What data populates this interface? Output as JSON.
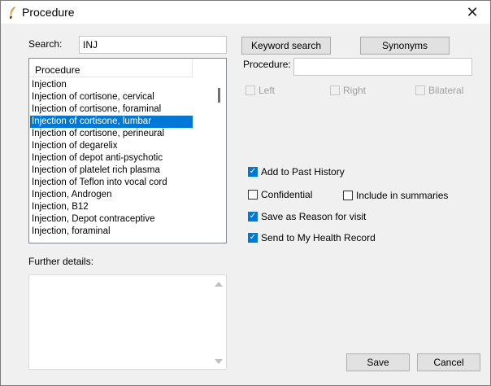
{
  "window": {
    "title": "Procedure",
    "close_glyph": "✕"
  },
  "search": {
    "label": "Search:",
    "value": "INJ"
  },
  "buttons": {
    "keyword_search": "Keyword search",
    "synonyms": "Synonyms",
    "save": "Save",
    "cancel": "Cancel"
  },
  "procedure": {
    "label": "Procedure:",
    "value": ""
  },
  "list": {
    "header": "Procedure",
    "selected_index": 3,
    "items": [
      "Injection",
      "Injection of cortisone, cervical",
      "Injection of cortisone, foraminal",
      "Injection of cortisone, lumbar",
      "Injection of cortisone, perineural",
      "Injection of degarelix",
      "Injection of depot anti-psychotic",
      "Injection of platelet rich plasma",
      "Injection of Teflon into vocal cord",
      "Injection, Androgen",
      "Injection, B12",
      "Injection, Depot contraceptive",
      "Injection, foraminal"
    ]
  },
  "laterality": {
    "left": "Left",
    "right": "Right",
    "bilateral": "Bilateral"
  },
  "options": {
    "add_to_past_history": {
      "label": "Add to Past History",
      "checked": true
    },
    "confidential": {
      "label": "Confidential",
      "checked": false
    },
    "include_in_summaries": {
      "label": "Include in summaries",
      "checked": false
    },
    "save_as_reason": {
      "label": "Save as Reason for visit",
      "checked": true
    },
    "send_to_mhr": {
      "label": "Send to My Health Record",
      "checked": true
    }
  },
  "further_details": {
    "label": "Further details:",
    "value": ""
  },
  "icons": {
    "app": "quill-icon",
    "check": "✓"
  }
}
